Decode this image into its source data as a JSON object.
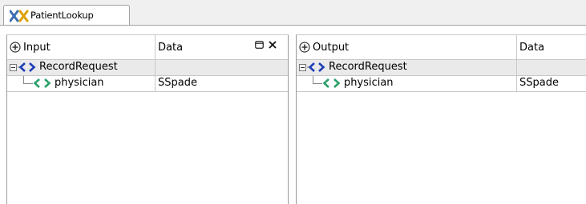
{
  "tab": {
    "label": "PatientLookup",
    "icon": "xml-mapper-icon"
  },
  "input_panel": {
    "header": {
      "name_col": "Input",
      "data_col": "Data"
    },
    "rows": [
      {
        "name": "RecordRequest",
        "data": ""
      },
      {
        "name": "physician",
        "data": "SSpade"
      }
    ]
  },
  "output_panel": {
    "header": {
      "name_col": "Output",
      "data_col": "Data"
    },
    "rows": [
      {
        "name": "RecordRequest",
        "data": ""
      },
      {
        "name": "physician",
        "data": "SSpade"
      }
    ]
  },
  "colors": {
    "element_tag": "#2aa06a",
    "expand_tag": "#1f3fb8",
    "row_highlight": "#eaeaea"
  }
}
